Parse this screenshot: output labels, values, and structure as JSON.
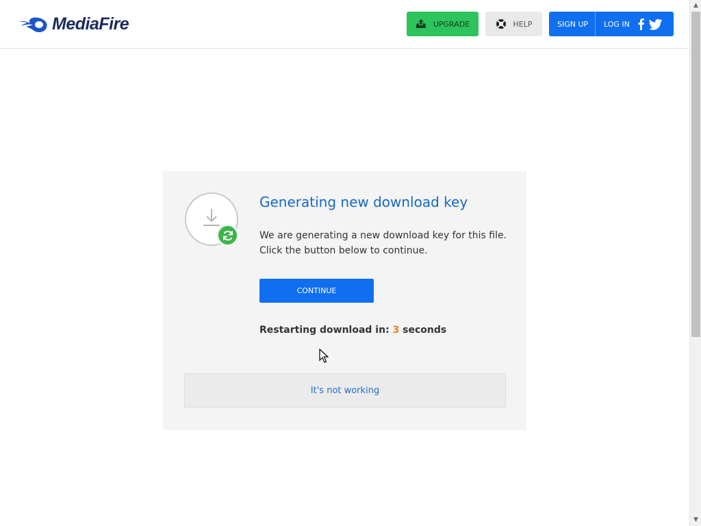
{
  "header": {
    "logo_text": "MediaFire",
    "upgrade_label": "UPGRADE",
    "help_label": "HELP",
    "signup_label": "SIGN UP",
    "login_label": "LOG IN",
    "social": [
      "facebook-icon",
      "twitter-icon"
    ]
  },
  "card": {
    "title": "Generating new download key",
    "description_line1": "We are generating a new download key for this file.",
    "description_line2": "Click the button below to continue.",
    "continue_label": "CONTINUE",
    "countdown_prefix": "Restarting download in: ",
    "countdown_value": "3",
    "countdown_suffix": " seconds",
    "not_working_label": "It's not working"
  },
  "colors": {
    "brand_blue": "#0f6ff0",
    "upgrade_green": "#2ec45d",
    "refresh_green": "#3cb54a",
    "title_blue": "#1269c9",
    "countdown_orange": "#ef7a24"
  }
}
